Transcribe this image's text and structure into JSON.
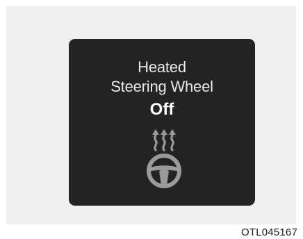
{
  "display": {
    "title_line1": "Heated",
    "title_line2": "Steering Wheel",
    "status": "Off",
    "icon": "heated-steering-wheel-icon",
    "colors": {
      "panel_bg": "#232323",
      "text": "#e8e8e8",
      "icon": "#9a9a9a"
    }
  },
  "caption": "OTL045167"
}
